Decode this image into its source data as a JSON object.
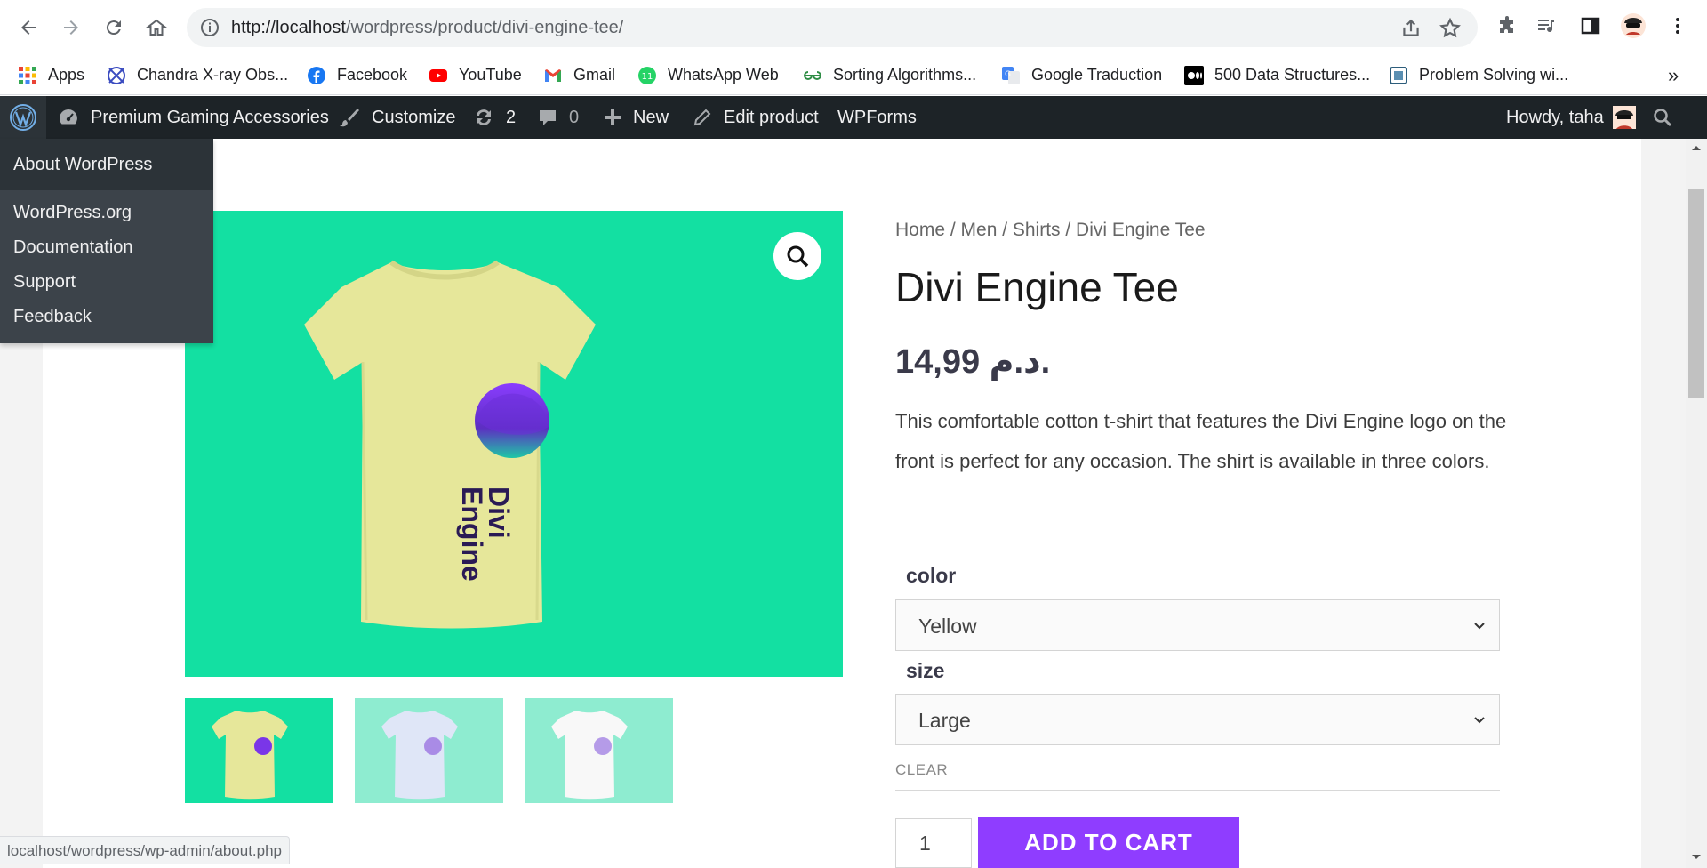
{
  "browser": {
    "url_host": "http://localhost",
    "url_path": "/wordpress/product/divi-engine-tee/",
    "bookmarks": [
      {
        "label": "Apps",
        "icon": "apps-grid-icon"
      },
      {
        "label": "Chandra X-ray Obs...",
        "icon": "chandra-icon"
      },
      {
        "label": "Facebook",
        "icon": "facebook-icon"
      },
      {
        "label": "YouTube",
        "icon": "youtube-icon"
      },
      {
        "label": "Gmail",
        "icon": "gmail-icon"
      },
      {
        "label": "WhatsApp Web",
        "icon": "whatsapp-icon"
      },
      {
        "label": "Sorting Algorithms...",
        "icon": "geeksforgeeks-icon"
      },
      {
        "label": "Google Traduction",
        "icon": "google-translate-icon"
      },
      {
        "label": "500 Data Structures...",
        "icon": "medium-icon"
      },
      {
        "label": "Problem Solving wi...",
        "icon": "book-icon"
      }
    ],
    "more_bookmarks": "»",
    "status_url": "localhost/wordpress/wp-admin/about.php"
  },
  "adminbar": {
    "site_name": "Premium Gaming Accessories",
    "customize": "Customize",
    "updates_count": "2",
    "comments_count": "0",
    "new": "New",
    "edit_product": "Edit product",
    "wpforms": "WPForms",
    "howdy": "Howdy, taha"
  },
  "wp_menu": {
    "about": "About WordPress",
    "items": [
      "WordPress.org",
      "Documentation",
      "Support",
      "Feedback"
    ]
  },
  "product": {
    "breadcrumb": "Home / Men / Shirts / Divi Engine Tee",
    "title": "Divi Engine Tee",
    "price": "14,99 د.م.",
    "description": "This comfortable cotton t-shirt that features the Divi Engine logo on the front is perfect for any occasion. The shirt is available in three colors.",
    "shirt_print": "Divi Engine",
    "color_label": "color",
    "color_value": "Yellow",
    "size_label": "size",
    "size_value": "Large",
    "clear": "CLEAR",
    "quantity": "1",
    "add_to_cart": "ADD TO CART"
  },
  "colors": {
    "image_bg": "#13e0a2",
    "thumb_bg": "#8eecd0",
    "accent": "#8f3dff",
    "adminbar": "#1d2327"
  }
}
